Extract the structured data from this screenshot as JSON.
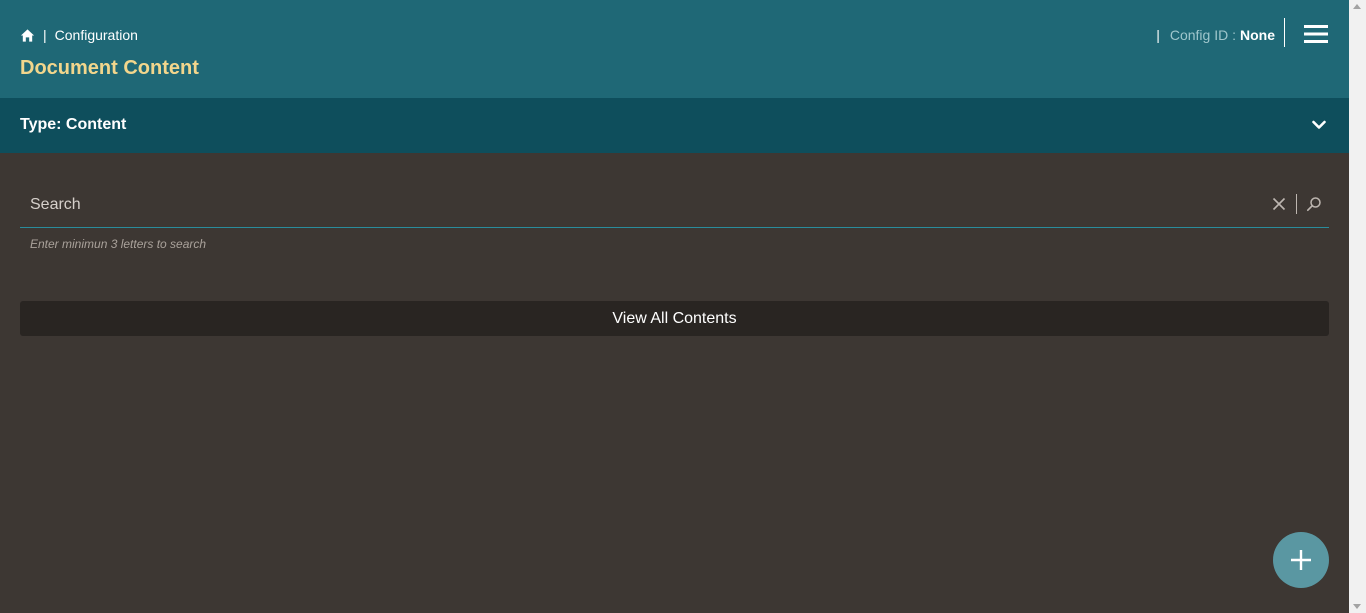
{
  "header": {
    "breadcrumb_separator": "|",
    "breadcrumb_current": "Configuration",
    "title": "Document Content",
    "config_separator": "|",
    "config_label": "Config ID :",
    "config_value": "None"
  },
  "type_bar": {
    "title": "Type: Content"
  },
  "search": {
    "placeholder": "Search",
    "value": "",
    "hint": "Enter minimun 3 letters to search"
  },
  "actions": {
    "view_all_label": "View All Contents"
  },
  "icons": {
    "home": "home-icon",
    "menu": "hamburger-menu-icon",
    "expand": "chevron-down-icon",
    "clear": "close-icon",
    "search": "search-icon",
    "add": "plus-icon"
  },
  "colors": {
    "header_bg": "#1f6876",
    "type_bar_bg": "#0e4e5c",
    "page_bg": "#3d3733",
    "title_accent": "#f2d68c",
    "button_bg": "#292522",
    "fab_bg": "#5a97a2"
  }
}
